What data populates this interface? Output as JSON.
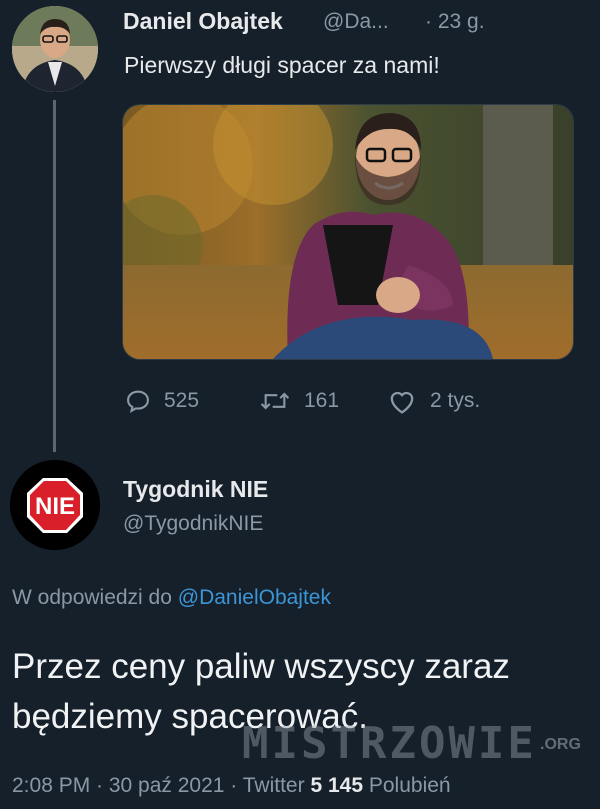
{
  "tweet1": {
    "author_name": "Daniel Obajtek",
    "handle": "@Da...",
    "time": "· 23 g.",
    "text": "Pierwszy długi spacer za nami!",
    "stats": {
      "replies": "525",
      "retweets": "161",
      "likes": "2 tys."
    }
  },
  "tweet2": {
    "author_name": "Tygodnik NIE",
    "handle": "@TygodnikNIE",
    "avatar_text": "NIE",
    "reply_to_prefix": "W odpowiedzi do",
    "reply_to_handle": "@DanielObajtek",
    "text": "Przez ceny paliw wszyscy zaraz będziemy spacerować.",
    "time": "2:08 PM · 30 paź 2021 · Twitter",
    "likes_count": "5 145",
    "likes_label": "Polubień"
  },
  "watermark": {
    "main": "MISTRZOWIE",
    "suffix": ".ORG"
  },
  "colors": {
    "background": "#15202b",
    "text_primary": "#e7e9ea",
    "text_secondary": "#8b98a5",
    "link": "#3c96d6",
    "nie_red": "#d9202a"
  }
}
